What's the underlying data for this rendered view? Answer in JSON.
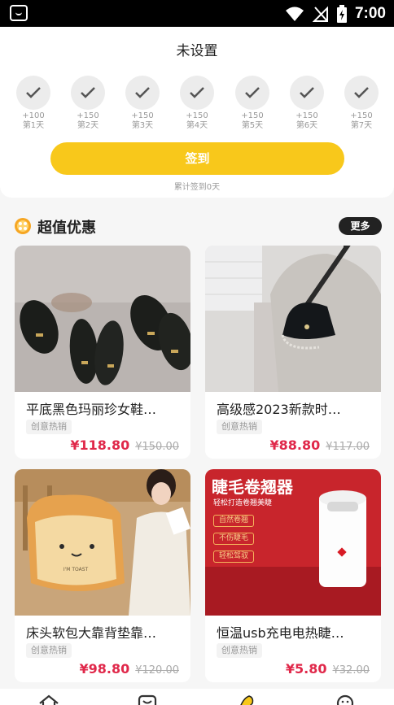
{
  "status_bar": {
    "time": "7:00"
  },
  "checkin": {
    "status": "未设置",
    "days": [
      {
        "points": "+100",
        "label": "第1天"
      },
      {
        "points": "+150",
        "label": "第2天"
      },
      {
        "points": "+150",
        "label": "第3天"
      },
      {
        "points": "+150",
        "label": "第4天"
      },
      {
        "points": "+150",
        "label": "第5天"
      },
      {
        "points": "+150",
        "label": "第6天"
      },
      {
        "points": "+150",
        "label": "第7天"
      }
    ],
    "button_label": "签到",
    "summary": "累计签到0天"
  },
  "deals": {
    "title": "超值优惠",
    "more_label": "更多",
    "products": [
      {
        "name": "平底黑色玛丽珍女鞋…",
        "tag": "创意热销",
        "price": "¥118.80",
        "old_price": "¥150.00"
      },
      {
        "name": "高级感2023新款时…",
        "tag": "创意热销",
        "price": "¥88.80",
        "old_price": "¥117.00"
      },
      {
        "name": "床头软包大靠背垫靠…",
        "tag": "创意热销",
        "price": "¥98.80",
        "old_price": "¥120.00"
      },
      {
        "name": "恒温usb充电电热睫…",
        "tag": "创意热销",
        "price": "¥5.80",
        "old_price": "¥32.00"
      }
    ],
    "ad": {
      "headline": "睫毛卷翘器",
      "subline": "轻松打造卷翘美睫",
      "features": [
        "自然卷翘",
        "不伤睫毛",
        "轻松驾驭"
      ],
      "pillow_text": "I'M TOAST"
    }
  },
  "colors": {
    "accent": "#f8c81b",
    "price": "#e0284a"
  },
  "icons": [
    "app-notification-icon",
    "wifi-icon",
    "signal-icon",
    "battery-icon",
    "check-icon",
    "deal-badge-icon",
    "home-icon",
    "shop-icon",
    "checkin-icon",
    "profile-icon"
  ]
}
